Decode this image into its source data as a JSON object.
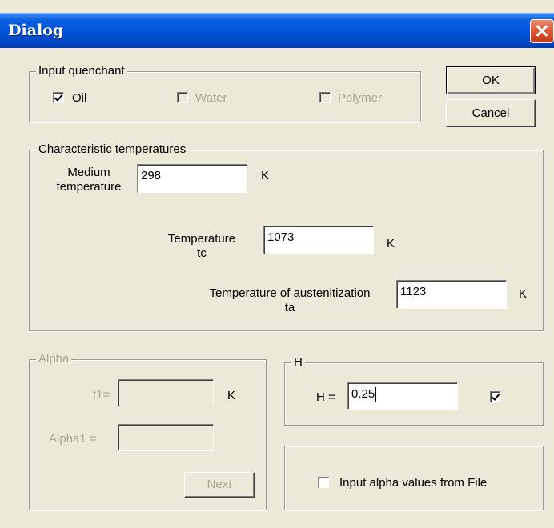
{
  "window": {
    "title": "Dialog"
  },
  "buttons": {
    "ok": "OK",
    "cancel": "Cancel",
    "next": "Next"
  },
  "quenchant": {
    "legend": "Input quenchant",
    "oil": {
      "label": "Oil",
      "checked": true
    },
    "water": {
      "label": "Water",
      "checked": false
    },
    "polymer": {
      "label": "Polymer",
      "checked": false
    }
  },
  "temps": {
    "legend": "Characteristic temperatures",
    "medium": {
      "label_line1": "Medium",
      "label_line2": "temperature",
      "value": "298",
      "unit": "K"
    },
    "tc": {
      "label_line1": "Temperature",
      "label_line2": "tc",
      "value": "1073",
      "unit": "K"
    },
    "ta": {
      "label_line1": "Temperature of austenitization",
      "label_line2": "ta",
      "value": "1123",
      "unit": "K"
    }
  },
  "alpha": {
    "legend": "Alpha",
    "t1": {
      "label": "t1=",
      "value": "",
      "unit": "K"
    },
    "alpha1": {
      "label": "Alpha1 =",
      "value": ""
    }
  },
  "h": {
    "legend": "H",
    "label": "H =",
    "value": "0.25",
    "checked": true
  },
  "file": {
    "label": "Input alpha values from File",
    "checked": false
  }
}
